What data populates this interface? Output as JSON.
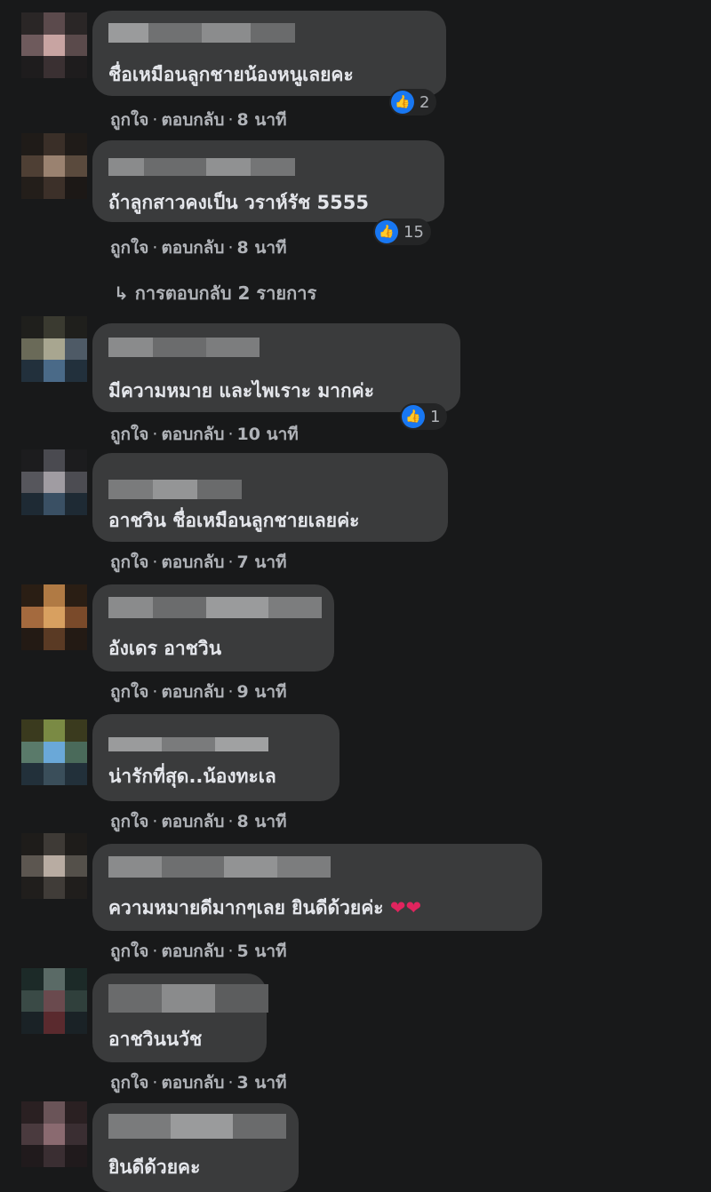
{
  "actions": {
    "like": "ถูกใจ",
    "reply": "ตอบกลับ",
    "separator": "·"
  },
  "comments": [
    {
      "text": "ชื่อเหมือนลูกชายน้องหนูเลยคะ",
      "time": "8 นาที",
      "reactions": "2"
    },
    {
      "text": "ถ้าลูกสาวคงเป็น วราห์รัช 5555",
      "time": "8 นาที",
      "reactions": "15",
      "replies_label": "การตอบกลับ 2 รายการ"
    },
    {
      "text": "มีความหมาย และไพเราะ มากค่ะ",
      "time": "10 นาที",
      "reactions": "1"
    },
    {
      "text": "อาชวิน ชื่อเหมือนลูกชายเลยค่ะ",
      "time": "7 นาที"
    },
    {
      "text": "อังเดร อาชวิน",
      "time": "9 นาที"
    },
    {
      "text": "น่ารักที่สุด..น้องทะเล",
      "time": "8 นาที"
    },
    {
      "text": "ความหมายดีมากๆเลย ยินดีด้วยค่ะ",
      "emoji": "❤❤",
      "time": "5 นาที"
    },
    {
      "text": "อาชวินนวัช",
      "time": "3 นาที"
    },
    {
      "text": "ยินดีด้วยคะ"
    }
  ],
  "icons": {
    "like": "like-thumb-icon",
    "reply_arrow": "reply-arrow-icon",
    "heart": "heart-icon"
  },
  "colors": {
    "background": "#18191a",
    "bubble": "#3a3b3c",
    "like_blue": "#1877f2",
    "heart_red": "#e0245e"
  }
}
